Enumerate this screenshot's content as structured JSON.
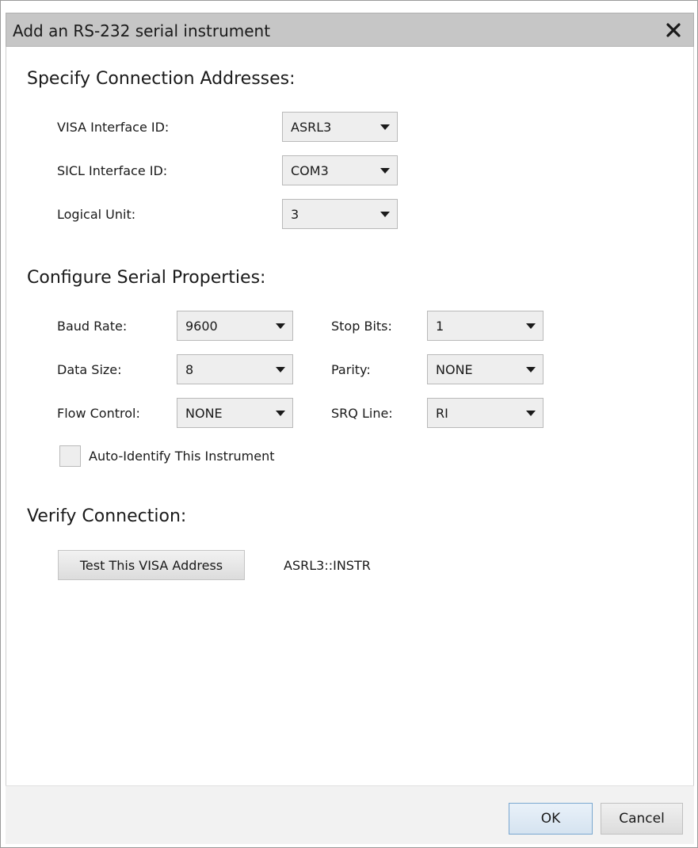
{
  "dialog": {
    "title": "Add an RS-232 serial instrument",
    "close_icon": "close-icon"
  },
  "connection": {
    "heading": "Specify Connection Addresses:",
    "visa_label": "VISA Interface ID:",
    "visa_value": "ASRL3",
    "sicl_label": "SICL Interface ID:",
    "sicl_value": "COM3",
    "lu_label": "Logical Unit:",
    "lu_value": "3"
  },
  "serial": {
    "heading": "Configure Serial Properties:",
    "baud_label": "Baud Rate:",
    "baud_value": "9600",
    "stop_label": "Stop Bits:",
    "stop_value": "1",
    "data_label": "Data Size:",
    "data_value": "8",
    "parity_label": "Parity:",
    "parity_value": "NONE",
    "flow_label": "Flow Control:",
    "flow_value": "NONE",
    "srq_label": "SRQ Line:",
    "srq_value": "RI",
    "auto_identify_label": "Auto-Identify This Instrument"
  },
  "verify": {
    "heading": "Verify Connection:",
    "test_button": "Test This VISA Address",
    "address": "ASRL3::INSTR"
  },
  "footer": {
    "ok": "OK",
    "cancel": "Cancel"
  },
  "colors": {
    "titlebar": "#c6c6c6",
    "select_bg": "#eeeeee",
    "ok_border": "#7aa7d0"
  }
}
